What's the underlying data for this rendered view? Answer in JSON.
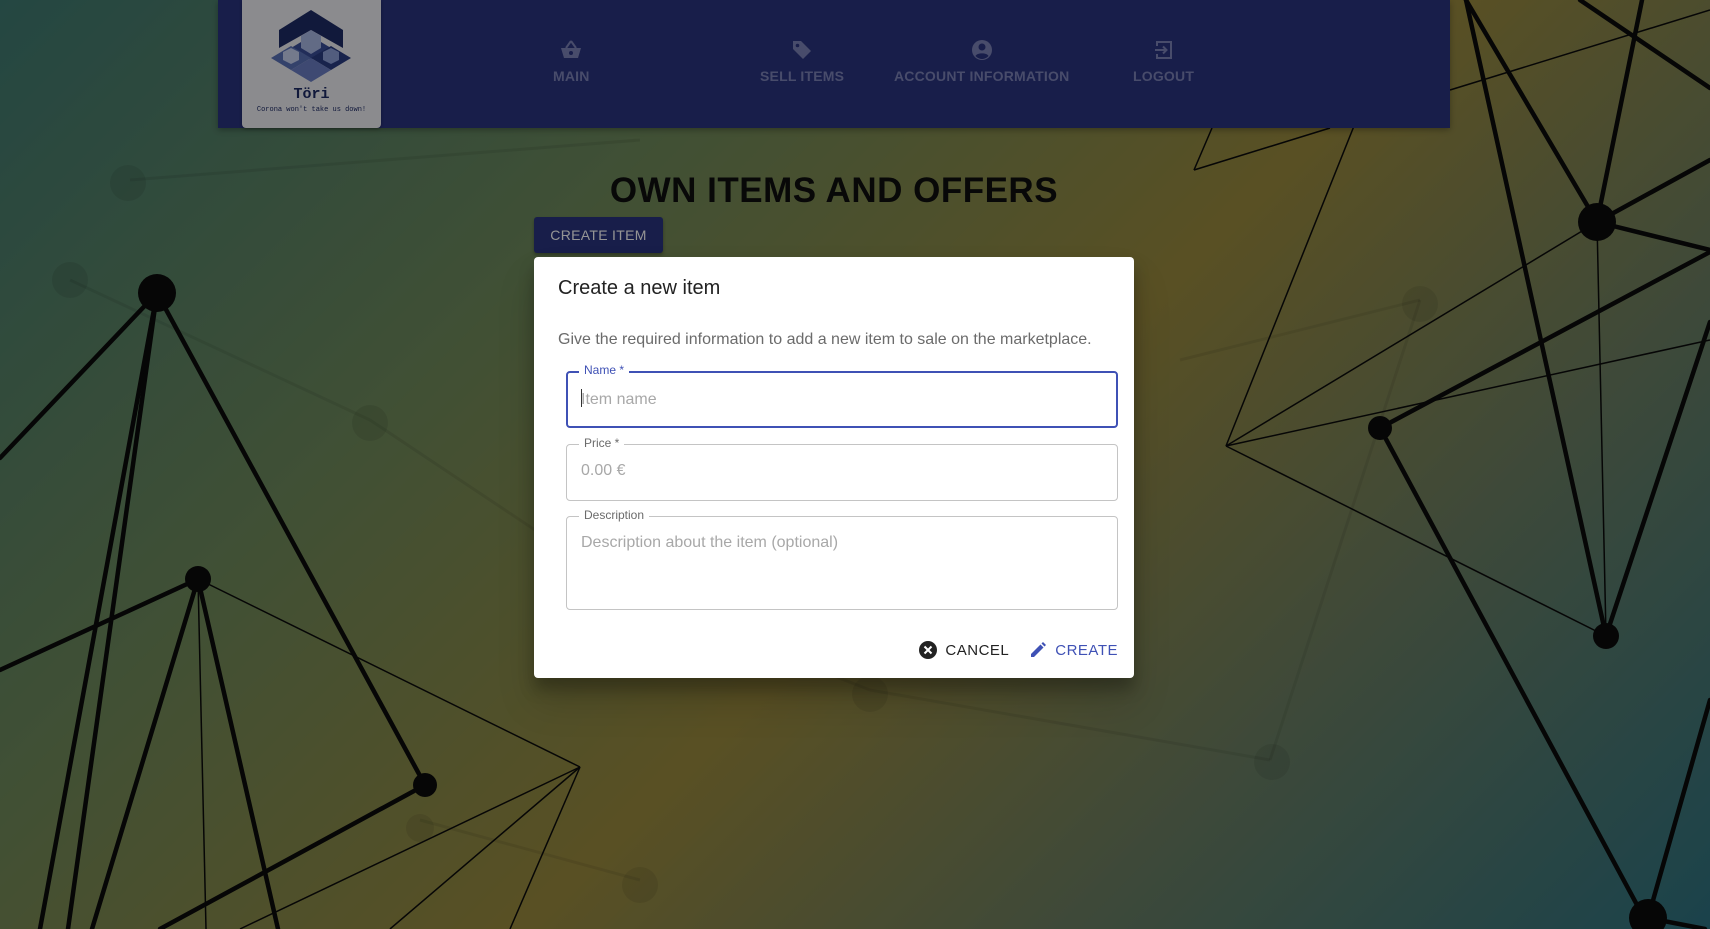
{
  "brand": {
    "name": "Töri",
    "tagline": "Corona won't take us down!"
  },
  "nav": [
    {
      "label": "MAIN",
      "icon": "basket-icon"
    },
    {
      "label": "SELL ITEMS",
      "icon": "tag-icon"
    },
    {
      "label": "ACCOUNT INFORMATION",
      "icon": "account-circle-icon"
    },
    {
      "label": "LOGOUT",
      "icon": "logout-icon"
    }
  ],
  "page": {
    "title": "OWN ITEMS AND OFFERS",
    "create_item_label": "CREATE ITEM"
  },
  "dialog": {
    "title": "Create a new item",
    "text": "Give the required information to add a new item to sale on the marketplace.",
    "fields": {
      "name": {
        "label": "Name *",
        "placeholder": "Item name",
        "value": ""
      },
      "price": {
        "label": "Price *",
        "placeholder": "0.00 €",
        "value": ""
      },
      "description": {
        "label": "Description",
        "placeholder": "Description about the item (optional)",
        "value": ""
      }
    },
    "actions": {
      "cancel_label": "CANCEL",
      "create_label": "CREATE"
    }
  },
  "colors": {
    "nav_bg": "#2a3480",
    "accent": "#3f51b5",
    "nav_text": "#7d83b8"
  }
}
